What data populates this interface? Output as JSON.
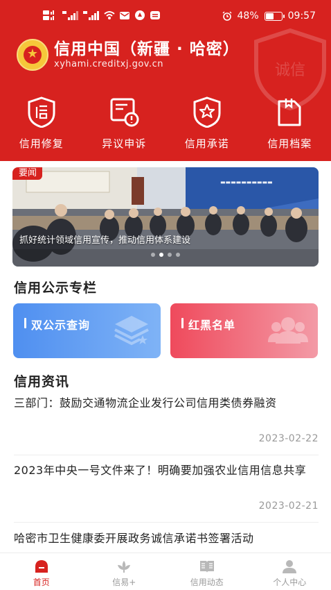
{
  "status_bar": {
    "battery": "48%",
    "battery_level": 0.48,
    "time": "09:57"
  },
  "header": {
    "title": "信用中国（新疆 · 哈密）",
    "url": "xyhami.creditxj.gov.cn",
    "watermark": "诚信"
  },
  "quick_nav": [
    {
      "label": "信用修复",
      "icon": "credit-repair-icon"
    },
    {
      "label": "异议申诉",
      "icon": "objection-appeal-icon"
    },
    {
      "label": "信用承诺",
      "icon": "credit-commitment-icon"
    },
    {
      "label": "信用档案",
      "icon": "credit-archive-icon"
    }
  ],
  "banner": {
    "tag": "要闻",
    "caption": "抓好统计领域信用宣传，推动信用体系建设",
    "slide_count": 4,
    "active_slide": 2
  },
  "publicity": {
    "title": "信用公示专栏",
    "cards": [
      {
        "label": "双公示查询",
        "icon": "stack-star-icon"
      },
      {
        "label": "红黑名单",
        "icon": "group-icon"
      }
    ]
  },
  "news": {
    "title": "信用资讯",
    "items": [
      {
        "title": "三部门：鼓励交通物流企业发行公司信用类债券融资",
        "date": "2023-02-22"
      },
      {
        "title": "2023年中央一号文件来了！明确要加强农业信用信息共享",
        "date": "2023-02-21"
      },
      {
        "title": "哈密市卫生健康委开展政务诚信承诺书签署活动"
      }
    ]
  },
  "tabbar": [
    {
      "label": "首页",
      "icon": "home-icon",
      "active": true
    },
    {
      "label": "信易+",
      "icon": "lotus-icon",
      "active": false
    },
    {
      "label": "信用动态",
      "icon": "book-icon",
      "active": false
    },
    {
      "label": "个人中心",
      "icon": "user-icon",
      "active": false
    }
  ],
  "colors": {
    "brand_red": "#d7221f",
    "card_blue": "#4f8ff0",
    "card_red": "#ef4a5c",
    "muted": "#999999"
  }
}
